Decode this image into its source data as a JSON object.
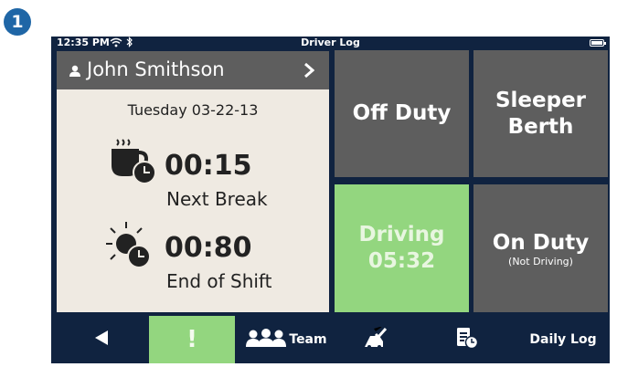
{
  "callout": {
    "number": "1"
  },
  "status_bar": {
    "time": "12:35 PM",
    "title": "Driver Log",
    "icons": [
      "wifi-icon",
      "bluetooth-icon",
      "battery-icon"
    ]
  },
  "driver": {
    "name": "John Smithson",
    "date": "Tuesday 03-22-13",
    "next_break": {
      "time": "00:15",
      "label": "Next Break",
      "icon": "coffee-clock-icon"
    },
    "end_of_shift": {
      "time": "00:80",
      "label": "End of Shift",
      "icon": "sun-clock-icon"
    }
  },
  "duty_tiles": {
    "off_duty": {
      "label": "Off Duty"
    },
    "sleeper": {
      "label_line1": "Sleeper",
      "label_line2": "Berth"
    },
    "driving": {
      "label": "Driving",
      "time": "05:32",
      "active": true
    },
    "on_duty": {
      "label": "On Duty",
      "sublabel": "(Not Driving)"
    }
  },
  "nav": {
    "back_icon": "back-arrow-icon",
    "alert_label": "!",
    "team_label": "Team",
    "inspection_icon": "truck-check-icon",
    "log_icon": "log-clock-icon",
    "daily_log_label": "Daily Log"
  },
  "colors": {
    "active_green": "#93d67f",
    "tile_gray": "#5e5e5e",
    "frame_navy": "#102340",
    "panel_beige": "#efeae2",
    "badge_blue": "#1f66a6"
  }
}
